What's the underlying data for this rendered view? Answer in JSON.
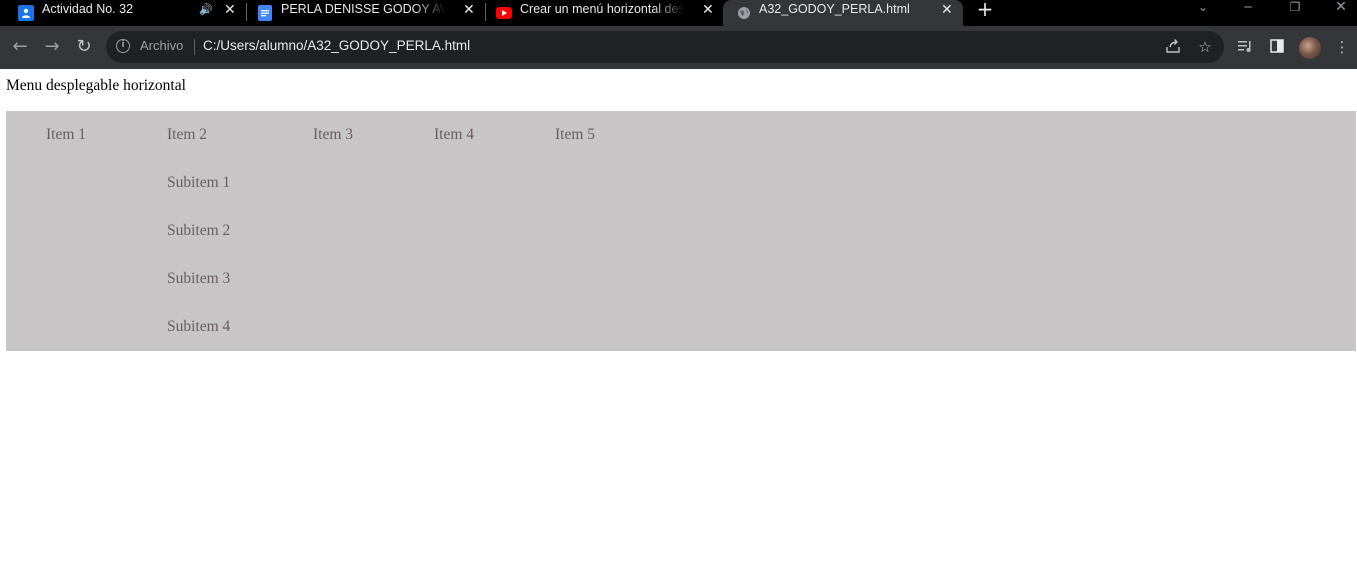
{
  "browser": {
    "tabs": [
      {
        "title": "Actividad No. 32",
        "favicon": "classroom-icon",
        "audio": true
      },
      {
        "title": "PERLA DENISSE GODOY AVILA -",
        "favicon": "docs-icon"
      },
      {
        "title": "Crear un menú horizontal desple",
        "favicon": "youtube-icon"
      },
      {
        "title": "A32_GODOY_PERLA.html",
        "favicon": "globe-icon",
        "active": true
      }
    ],
    "omnibox": {
      "security_label": "Archivo",
      "url": "C:/Users/alumno/A32_GODOY_PERLA.html"
    },
    "colors": {
      "tabstrip_bg": "#000000",
      "toolbar_bg": "#35363a",
      "omnibox_bg": "#202124"
    }
  },
  "page": {
    "heading": "Menu desplegable horizontal",
    "menu": {
      "items": [
        "Item 1",
        "Item 2",
        "Item 3",
        "Item 4",
        "Item 5"
      ],
      "open_item": "Item 2",
      "subitems": [
        "Subitem 1",
        "Subitem 2",
        "Subitem 3",
        "Subitem 4"
      ]
    },
    "colors": {
      "menu_bg": "#c8c5c6",
      "menu_text": "#6b5b5f"
    }
  }
}
